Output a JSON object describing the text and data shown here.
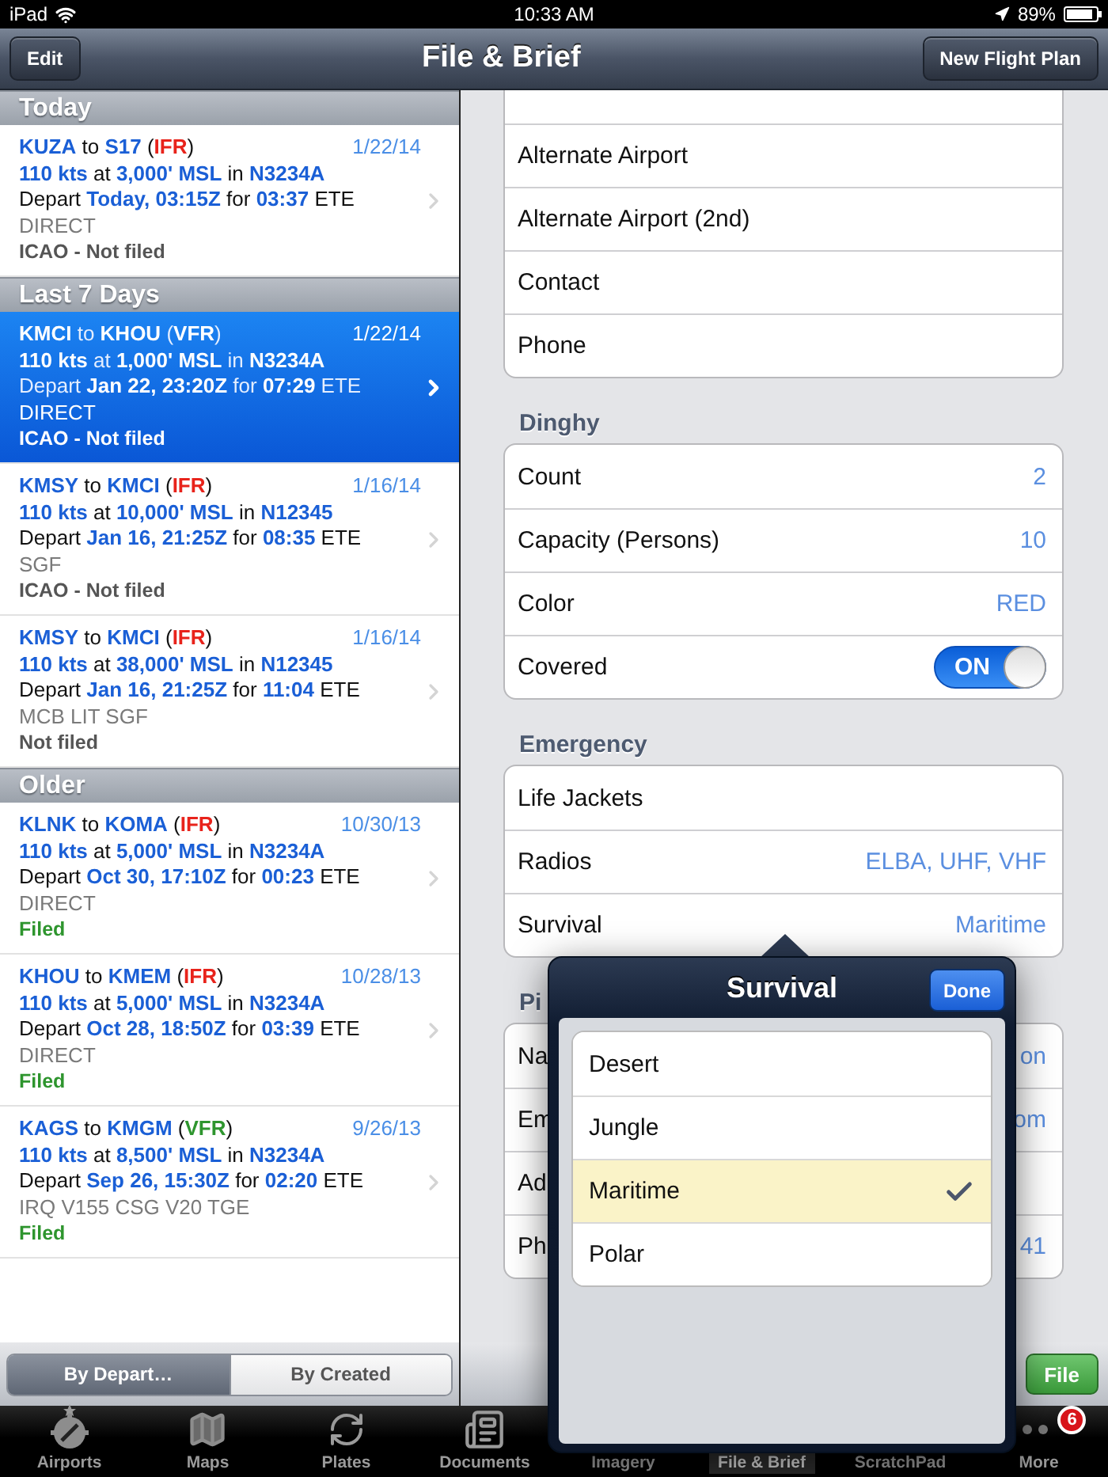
{
  "status_bar": {
    "device": "iPad",
    "time": "10:33 AM",
    "battery": "89%"
  },
  "nav": {
    "left_button": "Edit",
    "title": "File & Brief",
    "right_button": "New Flight Plan"
  },
  "plans": [
    {
      "title": "Today",
      "rows": [
        {
          "selected": false,
          "date": "1/22/14",
          "lines": [
            [
              {
                "kind": "value",
                "text": "KUZA"
              },
              {
                "kind": "plain",
                "text": " to "
              },
              {
                "kind": "value",
                "text": "S17"
              },
              {
                "kind": "plain",
                "text": " ("
              },
              {
                "kind": "ifr",
                "text": "IFR"
              },
              {
                "kind": "plain",
                "text": ")"
              }
            ],
            [
              {
                "kind": "value",
                "text": "110 kts"
              },
              {
                "kind": "plain",
                "text": " at "
              },
              {
                "kind": "value",
                "text": "3,000' MSL"
              },
              {
                "kind": "plain",
                "text": " in "
              },
              {
                "kind": "value",
                "text": "N3234A"
              }
            ],
            [
              {
                "kind": "plain",
                "text": "Depart "
              },
              {
                "kind": "value",
                "text": "Today, 03:15Z"
              },
              {
                "kind": "plain",
                "text": " for "
              },
              {
                "kind": "value",
                "text": "03:37"
              },
              {
                "kind": "plain",
                "text": " ETE"
              }
            ]
          ],
          "route": "DIRECT",
          "status": {
            "kind": "not_filed",
            "text": "ICAO - Not filed"
          }
        }
      ]
    },
    {
      "title": "Last 7 Days",
      "rows": [
        {
          "selected": true,
          "date": "1/22/14",
          "lines": [
            [
              {
                "kind": "value",
                "text": "KMCI"
              },
              {
                "kind": "plain",
                "text": " to "
              },
              {
                "kind": "value",
                "text": "KHOU"
              },
              {
                "kind": "plain",
                "text": " ("
              },
              {
                "kind": "vfr",
                "text": "VFR"
              },
              {
                "kind": "plain",
                "text": ")"
              }
            ],
            [
              {
                "kind": "value",
                "text": "110 kts"
              },
              {
                "kind": "plain",
                "text": " at "
              },
              {
                "kind": "value",
                "text": "1,000' MSL"
              },
              {
                "kind": "plain",
                "text": " in "
              },
              {
                "kind": "value",
                "text": "N3234A"
              }
            ],
            [
              {
                "kind": "plain",
                "text": "Depart "
              },
              {
                "kind": "value",
                "text": "Jan 22, 23:20Z"
              },
              {
                "kind": "plain",
                "text": " for "
              },
              {
                "kind": "value",
                "text": "07:29"
              },
              {
                "kind": "plain",
                "text": " ETE"
              }
            ]
          ],
          "route": "DIRECT",
          "status": {
            "kind": "not_filed",
            "text": "ICAO - Not filed"
          }
        },
        {
          "selected": false,
          "date": "1/16/14",
          "lines": [
            [
              {
                "kind": "value",
                "text": "KMSY"
              },
              {
                "kind": "plain",
                "text": " to "
              },
              {
                "kind": "value",
                "text": "KMCI"
              },
              {
                "kind": "plain",
                "text": " ("
              },
              {
                "kind": "ifr",
                "text": "IFR"
              },
              {
                "kind": "plain",
                "text": ")"
              }
            ],
            [
              {
                "kind": "value",
                "text": "110 kts"
              },
              {
                "kind": "plain",
                "text": " at "
              },
              {
                "kind": "value",
                "text": "10,000' MSL"
              },
              {
                "kind": "plain",
                "text": " in "
              },
              {
                "kind": "value",
                "text": "N12345"
              }
            ],
            [
              {
                "kind": "plain",
                "text": "Depart "
              },
              {
                "kind": "value",
                "text": "Jan 16, 21:25Z"
              },
              {
                "kind": "plain",
                "text": " for "
              },
              {
                "kind": "value",
                "text": "08:35"
              },
              {
                "kind": "plain",
                "text": " ETE"
              }
            ]
          ],
          "route": "SGF",
          "status": {
            "kind": "not_filed",
            "text": "ICAO - Not filed"
          }
        },
        {
          "selected": false,
          "date": "1/16/14",
          "lines": [
            [
              {
                "kind": "value",
                "text": "KMSY"
              },
              {
                "kind": "plain",
                "text": " to "
              },
              {
                "kind": "value",
                "text": "KMCI"
              },
              {
                "kind": "plain",
                "text": " ("
              },
              {
                "kind": "ifr",
                "text": "IFR"
              },
              {
                "kind": "plain",
                "text": ")"
              }
            ],
            [
              {
                "kind": "value",
                "text": "110 kts"
              },
              {
                "kind": "plain",
                "text": " at "
              },
              {
                "kind": "value",
                "text": "38,000' MSL"
              },
              {
                "kind": "plain",
                "text": " in "
              },
              {
                "kind": "value",
                "text": "N12345"
              }
            ],
            [
              {
                "kind": "plain",
                "text": "Depart "
              },
              {
                "kind": "value",
                "text": "Jan 16, 21:25Z"
              },
              {
                "kind": "plain",
                "text": " for "
              },
              {
                "kind": "value",
                "text": "11:04"
              },
              {
                "kind": "plain",
                "text": " ETE"
              }
            ]
          ],
          "route": "MCB LIT SGF",
          "status": {
            "kind": "not_filed",
            "text": "Not filed"
          }
        }
      ]
    },
    {
      "title": "Older",
      "rows": [
        {
          "selected": false,
          "date": "10/30/13",
          "lines": [
            [
              {
                "kind": "value",
                "text": "KLNK"
              },
              {
                "kind": "plain",
                "text": " to "
              },
              {
                "kind": "value",
                "text": "KOMA"
              },
              {
                "kind": "plain",
                "text": " ("
              },
              {
                "kind": "ifr",
                "text": "IFR"
              },
              {
                "kind": "plain",
                "text": ")"
              }
            ],
            [
              {
                "kind": "value",
                "text": "110 kts"
              },
              {
                "kind": "plain",
                "text": " at "
              },
              {
                "kind": "value",
                "text": "5,000' MSL"
              },
              {
                "kind": "plain",
                "text": " in "
              },
              {
                "kind": "value",
                "text": "N3234A"
              }
            ],
            [
              {
                "kind": "plain",
                "text": "Depart "
              },
              {
                "kind": "value",
                "text": "Oct 30, 17:10Z"
              },
              {
                "kind": "plain",
                "text": " for "
              },
              {
                "kind": "value",
                "text": "00:23"
              },
              {
                "kind": "plain",
                "text": " ETE"
              }
            ]
          ],
          "route": "DIRECT",
          "status": {
            "kind": "filed",
            "text": "Filed"
          }
        },
        {
          "selected": false,
          "date": "10/28/13",
          "lines": [
            [
              {
                "kind": "value",
                "text": "KHOU"
              },
              {
                "kind": "plain",
                "text": " to "
              },
              {
                "kind": "value",
                "text": "KMEM"
              },
              {
                "kind": "plain",
                "text": " ("
              },
              {
                "kind": "ifr",
                "text": "IFR"
              },
              {
                "kind": "plain",
                "text": ")"
              }
            ],
            [
              {
                "kind": "value",
                "text": "110 kts"
              },
              {
                "kind": "plain",
                "text": " at "
              },
              {
                "kind": "value",
                "text": "5,000' MSL"
              },
              {
                "kind": "plain",
                "text": " in "
              },
              {
                "kind": "value",
                "text": "N3234A"
              }
            ],
            [
              {
                "kind": "plain",
                "text": "Depart "
              },
              {
                "kind": "value",
                "text": "Oct 28, 18:50Z"
              },
              {
                "kind": "plain",
                "text": " for "
              },
              {
                "kind": "value",
                "text": "03:39"
              },
              {
                "kind": "plain",
                "text": " ETE"
              }
            ]
          ],
          "route": "DIRECT",
          "status": {
            "kind": "filed",
            "text": "Filed"
          }
        },
        {
          "selected": false,
          "date": "9/26/13",
          "lines": [
            [
              {
                "kind": "value",
                "text": "KAGS"
              },
              {
                "kind": "plain",
                "text": " to "
              },
              {
                "kind": "value",
                "text": "KMGM"
              },
              {
                "kind": "plain",
                "text": " ("
              },
              {
                "kind": "vfr",
                "text": "VFR"
              },
              {
                "kind": "plain",
                "text": ")"
              }
            ],
            [
              {
                "kind": "value",
                "text": "110 kts"
              },
              {
                "kind": "plain",
                "text": " at "
              },
              {
                "kind": "value",
                "text": "8,500' MSL"
              },
              {
                "kind": "plain",
                "text": " in "
              },
              {
                "kind": "value",
                "text": "N3234A"
              }
            ],
            [
              {
                "kind": "plain",
                "text": "Depart "
              },
              {
                "kind": "value",
                "text": "Sep 26, 15:30Z"
              },
              {
                "kind": "plain",
                "text": " for "
              },
              {
                "kind": "value",
                "text": "02:20"
              },
              {
                "kind": "plain",
                "text": " ETE"
              }
            ]
          ],
          "route": "IRQ V155 CSG V20 TGE",
          "status": {
            "kind": "filed",
            "text": "Filed"
          }
        }
      ]
    }
  ],
  "form": [
    {
      "rows": [
        {
          "kind": "value"
        },
        {
          "kind": "value",
          "label": "Alternate Airport"
        },
        {
          "kind": "value",
          "label": "Alternate Airport (2nd)"
        },
        {
          "kind": "value",
          "label": "Contact"
        },
        {
          "kind": "value",
          "label": "Phone"
        }
      ]
    },
    {
      "title": "Dinghy",
      "rows": [
        {
          "kind": "value",
          "label": "Count",
          "value": "2"
        },
        {
          "kind": "value",
          "label": "Capacity (Persons)",
          "value": "10"
        },
        {
          "kind": "value",
          "label": "Color",
          "value": "RED"
        },
        {
          "kind": "switch",
          "label": "Covered",
          "on": true,
          "switch_text": "ON"
        }
      ]
    },
    {
      "title": "Emergency",
      "rows": [
        {
          "kind": "value",
          "label": "Life Jackets"
        },
        {
          "kind": "value",
          "label": "Radios",
          "value": "ELBA, UHF, VHF"
        },
        {
          "kind": "value",
          "label": "Survival",
          "value": "Maritime"
        }
      ]
    },
    {
      "title": "Pi",
      "rows": [
        {
          "kind": "value",
          "label": "Na",
          "value": "on"
        },
        {
          "kind": "value",
          "label": "Em",
          "value": "om"
        },
        {
          "kind": "value",
          "label": "Ad"
        },
        {
          "kind": "value",
          "label": "Ph",
          "value": "41"
        }
      ]
    }
  ],
  "sort_control": [
    {
      "label": "By Depart…",
      "selected": true
    },
    {
      "label": "By Created",
      "selected": false
    }
  ],
  "file_button": "File",
  "popover": {
    "title": "Survival",
    "done_button": "Done",
    "options": [
      {
        "label": "Desert",
        "selected": false
      },
      {
        "label": "Jungle",
        "selected": false
      },
      {
        "label": "Maritime",
        "selected": true
      },
      {
        "label": "Polar",
        "selected": false
      }
    ]
  },
  "tab_bar": [
    {
      "label": "Airports",
      "selected": false
    },
    {
      "label": "Maps",
      "selected": false
    },
    {
      "label": "Plates",
      "selected": false
    },
    {
      "label": "Documents",
      "selected": false
    },
    {
      "label": "Imagery",
      "selected": false
    },
    {
      "label": "File & Brief",
      "selected": true
    },
    {
      "label": "ScratchPad",
      "selected": false
    },
    {
      "label": "More",
      "selected": false,
      "badge": "6"
    }
  ]
}
